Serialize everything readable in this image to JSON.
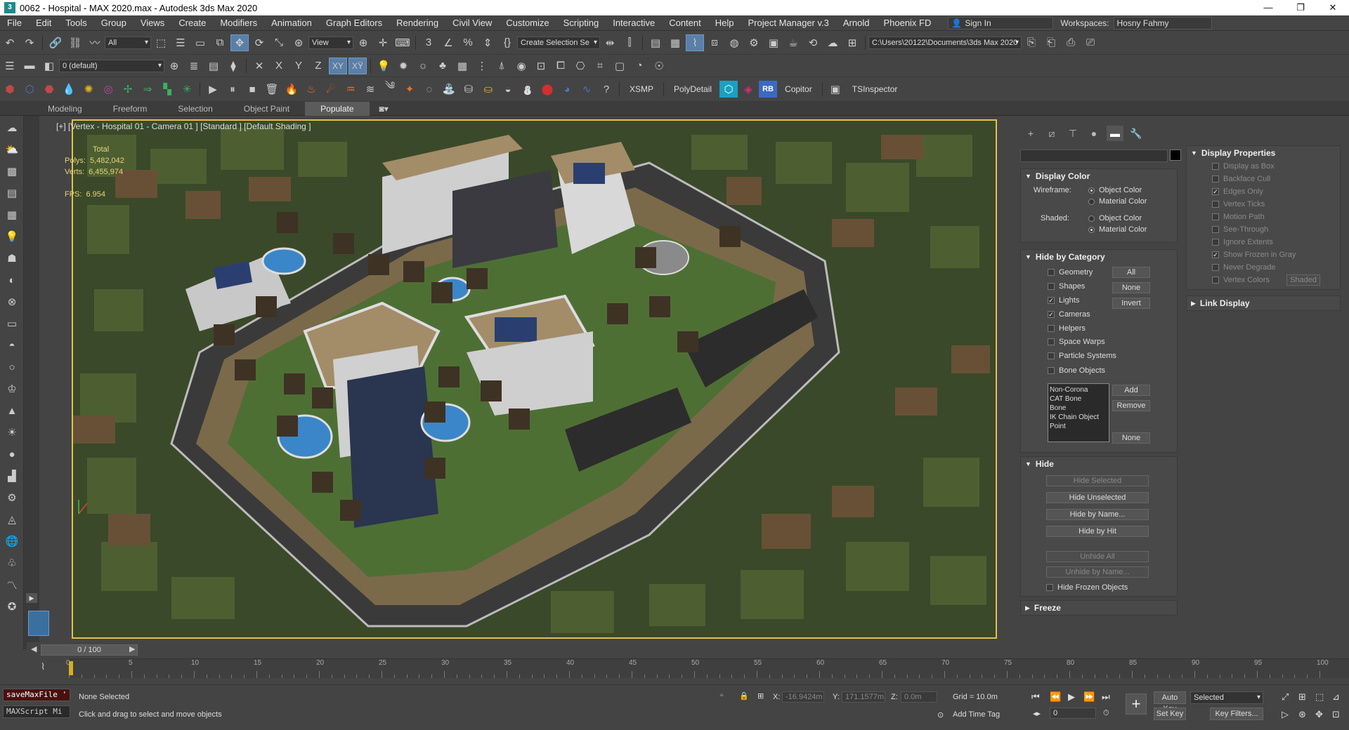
{
  "app": {
    "title": "0062 - Hospital - MAX 2020.max - Autodesk 3ds Max 2020",
    "logo": "3"
  },
  "window": {
    "minimize": "—",
    "restore": "❐",
    "close": "✕"
  },
  "menu": [
    "File",
    "Edit",
    "Tools",
    "Group",
    "Views",
    "Create",
    "Modifiers",
    "Animation",
    "Graph Editors",
    "Rendering",
    "Civil View",
    "Customize",
    "Scripting",
    "Interactive",
    "Content",
    "Help",
    "Project Manager v.3",
    "Arnold",
    "Phoenix FD"
  ],
  "account": {
    "signin": "Sign In",
    "workspaces_label": "Workspaces:",
    "workspace": "Hosny Fahmy"
  },
  "toolbar1": {
    "filter": "All",
    "view": "View",
    "selection_set": "Create Selection Se",
    "project_path": "C:\\Users\\20122\\Documents\\3ds Max 2020"
  },
  "toolbar2": {
    "layer": "0 (default)",
    "axes": [
      "X",
      "Y",
      "Z",
      "XY",
      "XŸ"
    ]
  },
  "toolbar3": {
    "xsmp": "XSMP",
    "polydetail": "PolyDetail",
    "rb": "RB",
    "copitor": "Copitor",
    "tsinspector": "TSInspector"
  },
  "ribbon": {
    "tabs": [
      "Modeling",
      "Freeform",
      "Selection",
      "Object Paint",
      "Populate"
    ],
    "active": "Populate"
  },
  "viewport": {
    "label": "[+] [Vertex - Hospital 01 - Camera 01 ] [Standard ] [Default Shading ]",
    "stats": {
      "total_label": "Total",
      "polys_label": "Polys:",
      "polys": "5,482,042",
      "verts_label": "Verts:",
      "verts": "6,455,974",
      "fps_label": "FPS:",
      "fps": "6.954"
    }
  },
  "cmdpanel": {
    "display_color": {
      "title": "Display Color",
      "wireframe_label": "Wireframe:",
      "shaded_label": "Shaded:",
      "object_color": "Object Color",
      "material_color": "Material Color"
    },
    "hide_by_category": {
      "title": "Hide by Category",
      "items": [
        {
          "label": "Geometry",
          "checked": false
        },
        {
          "label": "Shapes",
          "checked": false
        },
        {
          "label": "Lights",
          "checked": true
        },
        {
          "label": "Cameras",
          "checked": true
        },
        {
          "label": "Helpers",
          "checked": false
        },
        {
          "label": "Space Warps",
          "checked": false
        },
        {
          "label": "Particle Systems",
          "checked": false
        },
        {
          "label": "Bone Objects",
          "checked": false
        }
      ],
      "btn_all": "All",
      "btn_none": "None",
      "btn_invert": "Invert",
      "list": [
        "Non-Corona",
        "CAT Bone",
        "Bone",
        "IK Chain Object",
        "Point"
      ],
      "btn_add": "Add",
      "btn_remove": "Remove",
      "btn_none2": "None"
    },
    "hide": {
      "title": "Hide",
      "hide_selected": "Hide Selected",
      "hide_unselected": "Hide Unselected",
      "hide_by_name": "Hide by Name...",
      "hide_by_hit": "Hide by Hit",
      "unhide_all": "Unhide All",
      "unhide_by_name": "Unhide by Name...",
      "hide_frozen": "Hide Frozen Objects"
    },
    "freeze": {
      "title": "Freeze"
    }
  },
  "display_properties": {
    "title": "Display Properties",
    "items": [
      "Display as Box",
      "Backface Cull",
      "Edges Only",
      "Vertex Ticks",
      "Motion Path",
      "See-Through",
      "Ignore Extents",
      "Show Frozen in Gray",
      "Never Degrade",
      "Vertex Colors"
    ],
    "shaded_btn": "Shaded"
  },
  "link_display": {
    "title": "Link Display"
  },
  "timeline": {
    "frame": "0 / 100",
    "labels": [
      "0",
      "5",
      "10",
      "15",
      "20",
      "25",
      "30",
      "35",
      "40",
      "45",
      "50",
      "55",
      "60",
      "65",
      "70",
      "75",
      "80",
      "85",
      "90",
      "95",
      "100"
    ]
  },
  "status": {
    "script1": "saveMaxFile '",
    "script2": "MAXScript Mi",
    "selection": "None Selected",
    "prompt": "Click and drag to select and move objects",
    "x_label": "X:",
    "x": "-16.9424m",
    "y_label": "Y:",
    "y": "171.1577m",
    "z_label": "Z:",
    "z": "0.0m",
    "grid": "Grid = 10.0m",
    "add_time_tag": "Add Time Tag",
    "auto_key": "Auto Key",
    "set_key": "Set Key",
    "selected": "Selected",
    "key_filters": "Key Filters...",
    "frame_field": "0"
  }
}
